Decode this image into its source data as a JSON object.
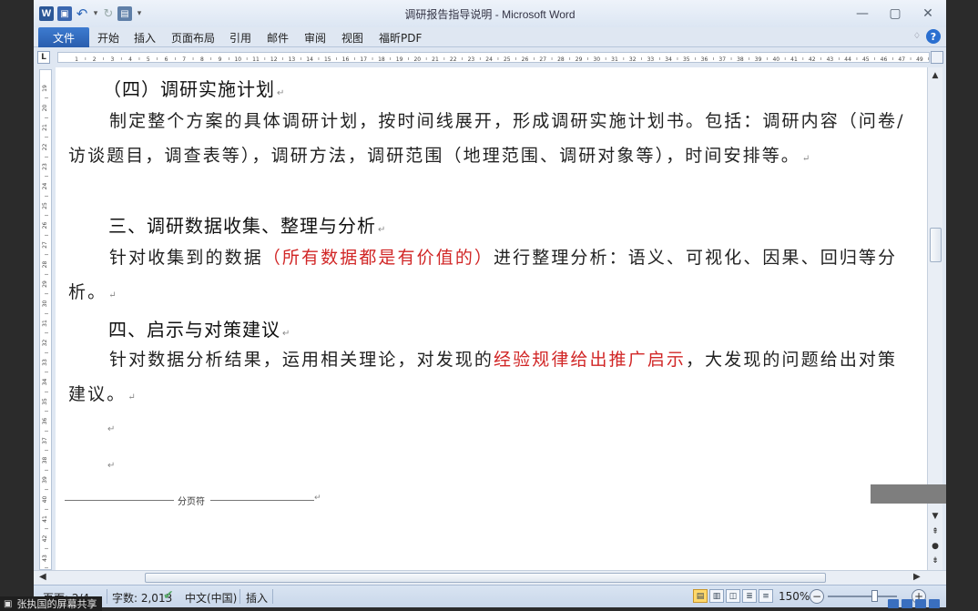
{
  "window": {
    "title": "调研报告指导说明 - Microsoft Word",
    "min_icon": "minimize-icon",
    "max_icon": "maximize-icon",
    "close_icon": "close-icon"
  },
  "quick_access": {
    "word_logo": "W",
    "icons": [
      "word-logo-icon",
      "save-icon",
      "undo-icon",
      "redo-icon",
      "print-preview-icon",
      "customize-dropdown-icon"
    ]
  },
  "ribbon": {
    "file_tab": "文件",
    "tabs": [
      "开始",
      "插入",
      "页面布局",
      "引用",
      "邮件",
      "审阅",
      "视图",
      "福昕PDF"
    ],
    "help": "?"
  },
  "ruler": {
    "tab_selector": "L",
    "numbers": [
      1,
      2,
      3,
      4,
      5,
      6,
      7,
      8,
      9,
      10,
      11,
      12,
      13,
      14,
      15,
      16,
      17,
      18,
      19,
      20,
      21,
      22,
      23,
      24,
      25,
      26,
      27,
      28,
      29,
      30,
      31,
      32,
      33,
      34,
      35,
      36,
      37,
      38,
      39,
      40,
      41,
      42,
      43,
      44,
      45,
      46,
      47,
      49
    ],
    "vnumbers": [
      19,
      20,
      21,
      22,
      23,
      24,
      25,
      26,
      27,
      28,
      29,
      30,
      31,
      32,
      33,
      34,
      35,
      36,
      37,
      38,
      39,
      40,
      41,
      42,
      43
    ]
  },
  "document": {
    "section4_heading": "（四）调研实施计划",
    "section4_body": "制定整个方案的具体调研计划，按时间线展开，形成调研实施计划书。包括：调研内容（问卷/访谈题目，调查表等），调研方法，调研范围（地理范围、调研对象等），时间安排等。",
    "heading3": "三、调研数据收集、整理与分析",
    "para3_a": "针对收集到的数据",
    "para3_red": "（所有数据都是有价值的）",
    "para3_b": "进行整理分析：语义、可视化、因果、回归等分析。",
    "heading4": "四、启示与对策建议",
    "para4_a": "针对数据分析结果，运用相关理论，对发现的",
    "para4_red": "经验规律给出推广启示",
    "para4_b": "，大发现的问题给出对策建议。",
    "paragraph_mark": "↵",
    "page_break_label": "分页符"
  },
  "statusbar": {
    "page": "页面: 2/4",
    "words": "字数: 2,013",
    "language": "中文(中国)",
    "mode": "插入",
    "zoom": "150%",
    "zoom_out": "−",
    "zoom_in": "+"
  },
  "screenshare": {
    "label": "张执国的屏幕共享"
  },
  "colors": {
    "accent": "#2a5eae",
    "highlight_red": "#d12626"
  }
}
